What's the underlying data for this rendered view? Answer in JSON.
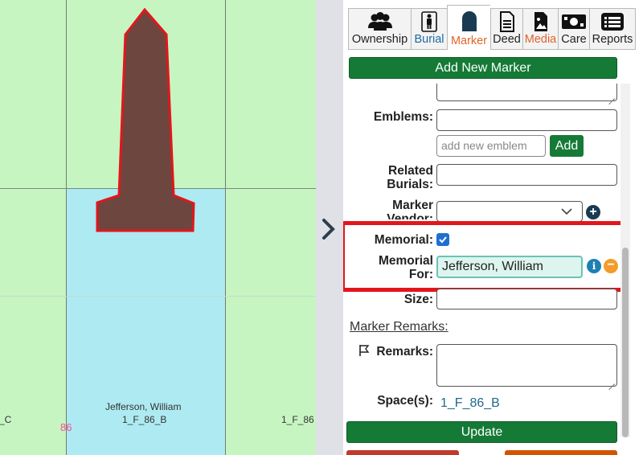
{
  "map": {
    "plot_name": "Jefferson, William",
    "plot_id": "1_F_86_B",
    "left_plot_id_fragment": "_C",
    "right_plot_id_fragment": "1_F_86",
    "section_number": "86",
    "colors": {
      "grass": "#c6f5c1",
      "selected_plot": "#aeeaf2",
      "marker_fill": "#6e4640",
      "marker_outline": "#e3161b",
      "section_number": "#ff4a9b"
    }
  },
  "toggle": {
    "icon": "chevron-right-icon"
  },
  "tabs": [
    {
      "label": "Ownership",
      "icon": "users-icon"
    },
    {
      "label": "Burial",
      "icon": "person-icon"
    },
    {
      "label": "Marker",
      "icon": "headstone-icon",
      "active": true
    },
    {
      "label": "Deed",
      "icon": "document-icon"
    },
    {
      "label": "Media",
      "icon": "image-file-icon"
    },
    {
      "label": "Care",
      "icon": "money-icon"
    },
    {
      "label": "Reports",
      "icon": "list-icon"
    }
  ],
  "add_marker_label": "Add New Marker",
  "form": {
    "emblems_label": "Emblems:",
    "emblems_value": "",
    "new_emblem_placeholder": "add new emblem",
    "add_emblem_label": "Add",
    "related_burials_label": "Related Burials:",
    "related_burials_value": "",
    "marker_vendor_label": "Marker Vendor:",
    "marker_vendor_value": "",
    "memorial_label": "Memorial:",
    "memorial_checked": true,
    "memorial_for_label": "Memorial For:",
    "memorial_for_value": "Jefferson, William",
    "size_label": "Size:",
    "size_value": "",
    "marker_remarks_heading": "Marker Remarks:",
    "remarks_label": "Remarks:",
    "remarks_value": "",
    "spaces_label": "Space(s):",
    "spaces_value": "1_F_86_B"
  },
  "update_label": "Update",
  "colors": {
    "primary_green": "#157a36",
    "active_tab": "#e0642a",
    "info_blue": "#1d80b3",
    "remove_orange": "#f39c2b",
    "highlight_red": "#e3161b",
    "bottom_red": "#c0392b",
    "bottom_orange": "#d35400"
  }
}
